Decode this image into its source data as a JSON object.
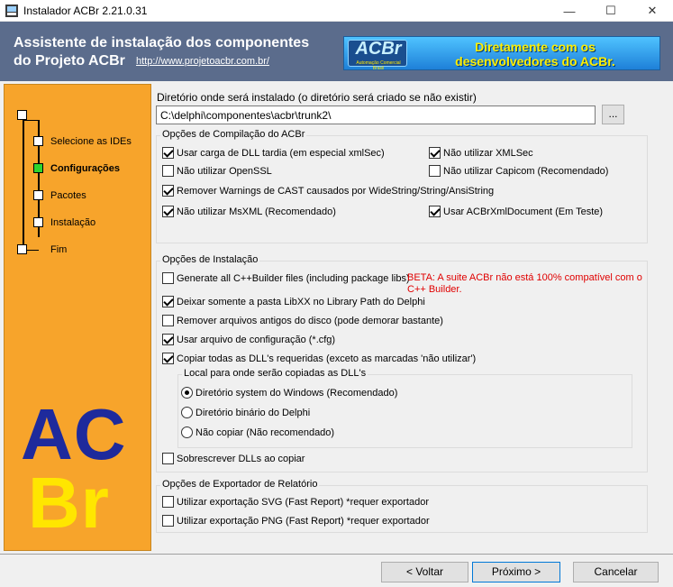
{
  "window": {
    "title": "Instalador ACBr 2.21.0.31",
    "min_glyph": "—",
    "max_glyph": "☐",
    "close_glyph": "✕"
  },
  "header": {
    "title_line1": "Assistente de instalação dos componentes",
    "title_line2": "do Projeto ACBr",
    "link": "http://www.projetoacbr.com.br/",
    "banner_logo": "ACBr",
    "banner_logo_sub": "Automação Comercial Brasil",
    "banner_line1": "Diretamente com os",
    "banner_line2": "desenvolvedores do ACBr."
  },
  "steps": [
    {
      "label": "Selecione as IDEs",
      "active": false
    },
    {
      "label": "Configurações",
      "active": true
    },
    {
      "label": "Pacotes",
      "active": false
    },
    {
      "label": "Instalação",
      "active": false
    },
    {
      "label": "Fim",
      "active": false
    }
  ],
  "side_logo": {
    "top": "AC",
    "bottom": "Br"
  },
  "directory": {
    "label": "Diretório onde será instalado (o diretório será criado se não existir)",
    "value": "C:\\delphi\\componentes\\acbr\\trunk2\\",
    "browse_label": "..."
  },
  "compile_group": {
    "legend": "Opções de Compilação do ACBr",
    "options": [
      {
        "label": "Usar carga de DLL tardia (em especial xmlSec)",
        "checked": true
      },
      {
        "label": "Não utilizar XMLSec",
        "checked": true
      },
      {
        "label": "Não utilizar OpenSSL",
        "checked": false
      },
      {
        "label": "Não utilizar Capicom (Recomendado)",
        "checked": false
      },
      {
        "label": "Remover Warnings de CAST causados por WideString/String/AnsiString",
        "checked": true
      },
      {
        "label": "Não utilizar MsXML (Recomendado)",
        "checked": true
      },
      {
        "label": "Usar ACBrXmlDocument (Em Teste)",
        "checked": true
      }
    ]
  },
  "install_group": {
    "legend": "Opções de Instalação",
    "options": [
      {
        "label": "Generate all C++Builder files (including package libs)",
        "checked": false
      },
      {
        "label": "Deixar somente a pasta LibXX no Library Path do Delphi",
        "checked": true
      },
      {
        "label": "Remover arquivos antigos do disco (pode demorar bastante)",
        "checked": false
      },
      {
        "label": "Usar arquivo de configuração (*.cfg)",
        "checked": true
      },
      {
        "label": "Copiar todas as DLL's requeridas (exceto as marcadas 'não utilizar')",
        "checked": true
      },
      {
        "label": "Sobrescrever DLLs ao copiar",
        "checked": false
      }
    ],
    "beta_note": "BETA: A suite ACBr não está 100% compatível com o C++ Builder.",
    "local_group": {
      "legend": "Local para onde serão copiadas as DLL's",
      "options": [
        {
          "label": "Diretório system do Windows (Recomendado)",
          "checked": true
        },
        {
          "label": "Diretório binário do Delphi",
          "checked": false
        },
        {
          "label": "Não copiar (Não recomendado)",
          "checked": false
        }
      ]
    }
  },
  "export_group": {
    "legend": "Opções de Exportador de Relatório",
    "options": [
      {
        "label": "Utilizar exportação SVG (Fast Report) *requer exportador",
        "checked": false
      },
      {
        "label": "Utilizar exportação PNG (Fast Report) *requer exportador",
        "checked": false
      }
    ]
  },
  "buttons": {
    "back": "< Voltar",
    "next": "Próximo >",
    "cancel": "Cancelar"
  }
}
